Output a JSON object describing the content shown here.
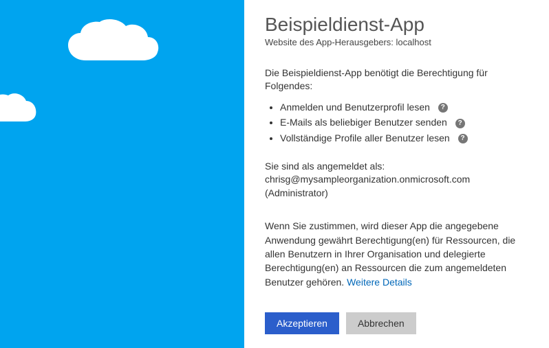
{
  "header": {
    "title": "Beispieldienst-App",
    "publisher_prefix": "Website des App-Herausgebers: ",
    "publisher_host": "localhost"
  },
  "permissions": {
    "intro": "Die Beispieldienst-App benötigt die Berechtigung für Folgendes:",
    "items": [
      "Anmelden und Benutzerprofil lesen",
      "E-Mails als beliebiger Benutzer senden",
      "Vollständige Profile aller Benutzer lesen"
    ]
  },
  "signed_in": {
    "line1": "Sie sind als angemeldet als:",
    "email": "chrisg@mysampleorganization.onmicrosoft.com",
    "role": "(Administrator)"
  },
  "consent": {
    "text": "Wenn Sie zustimmen, wird dieser App die angegebene Anwendung gewährt Berechtigung(en) für Ressourcen, die allen Benutzern in Ihrer Organisation und delegierte Berechtigung(en) an Ressourcen die zum angemeldeten Benutzer gehören. ",
    "link": "Weitere Details"
  },
  "buttons": {
    "accept": "Akzeptieren",
    "cancel": "Abbrechen"
  },
  "help_glyph": "?"
}
